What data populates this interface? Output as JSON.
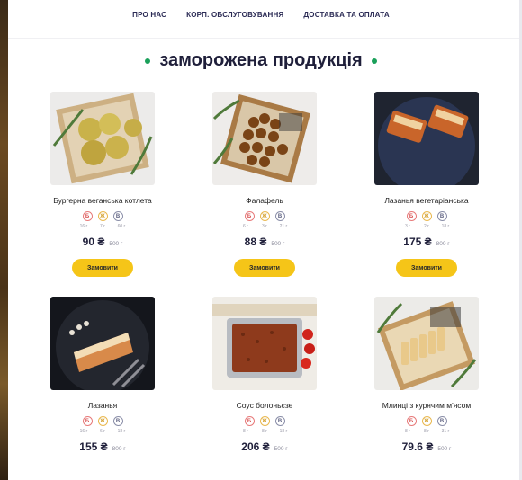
{
  "nav": {
    "items": [
      "ПРО НАС",
      "КОРП. ОБСЛУГОВУВАННЯ",
      "ДОСТАВКА ТА ОПЛАТА"
    ]
  },
  "section": {
    "title": "заморожена продукція"
  },
  "order_label": "Замовити",
  "colors": {
    "accent_yellow": "#f5c518",
    "title_dot_green": "#1aa05a",
    "text_dark": "#1f1f3a"
  },
  "products": [
    {
      "name": "Бургерна веганська котлета",
      "badges": [
        "Б",
        "Ж",
        "В"
      ],
      "macros": [
        "16 г",
        "7 г",
        "60 г"
      ],
      "price": "90 ₴",
      "weight": "500 г"
    },
    {
      "name": "Фалафель",
      "badges": [
        "Б",
        "Ж",
        "В"
      ],
      "macros": [
        "6 г",
        "3 г",
        "21 г"
      ],
      "price": "88 ₴",
      "weight": "500 г"
    },
    {
      "name": "Лазанья вегетаріанська",
      "badges": [
        "Б",
        "Ж",
        "В"
      ],
      "macros": [
        "3 г",
        "2 г",
        "18 г"
      ],
      "price": "175 ₴",
      "weight": "800 г"
    },
    {
      "name": "Лазанья",
      "badges": [
        "Б",
        "Ж",
        "В"
      ],
      "macros": [
        "16 г",
        "6 г",
        "18 г"
      ],
      "price": "155 ₴",
      "weight": "800 г"
    },
    {
      "name": "Соус болоньєзе",
      "badges": [
        "Б",
        "Ж",
        "В"
      ],
      "macros": [
        "8 г",
        "8 г",
        "18 г"
      ],
      "price": "206 ₴",
      "weight": "500 г"
    },
    {
      "name": "Млинці з курячим м'ясом",
      "badges": [
        "Б",
        "Ж",
        "В"
      ],
      "macros": [
        "8 г",
        "8 г",
        "31 г"
      ],
      "price": "79.6 ₴",
      "weight": "500 г"
    }
  ]
}
